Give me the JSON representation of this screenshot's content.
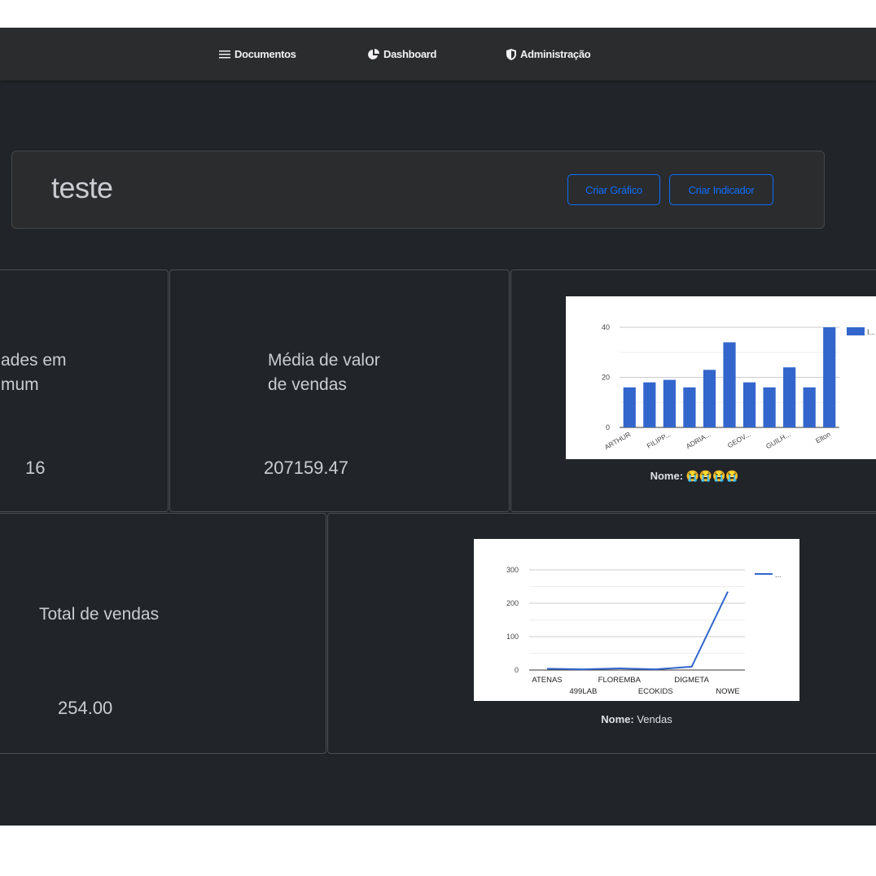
{
  "nav": {
    "documents_label": "Documentos",
    "dashboard_label": "Dashboard",
    "admin_label": "Administração"
  },
  "header": {
    "title": "teste",
    "create_chart_label": "Criar Gráfico",
    "create_indicator_label": "Criar Indicador"
  },
  "indicators": [
    {
      "title_line1": "ades em",
      "title_line2": "mum",
      "value": "16"
    },
    {
      "title_line1": "Média de valor",
      "title_line2": "de vendas",
      "value": "207159.47"
    },
    {
      "title_line1": "Total de vendas",
      "title_line2": "",
      "value": "254.00"
    }
  ],
  "charts_caption": [
    {
      "label": "Nome:",
      "text": "😭😭😭😭"
    },
    {
      "label": "Nome:",
      "text": "Vendas"
    }
  ],
  "colors": {
    "bar": "#3366cc",
    "line": "#3366cc",
    "accent": "#0d6efd"
  },
  "chart_data": [
    {
      "type": "bar",
      "categories": [
        "ARTHUR",
        "",
        "FILIPP...",
        "",
        "ADRIA...",
        "",
        "GEOV...",
        "",
        "GUILH...",
        "",
        "Elton"
      ],
      "values": [
        16,
        18,
        19,
        16,
        23,
        34,
        18,
        16,
        24,
        16,
        40
      ],
      "ylim": [
        0,
        40
      ],
      "yticks": [
        0,
        20,
        40
      ],
      "legend": "I...",
      "legend_position": "right"
    },
    {
      "type": "line",
      "x": [
        "ATENAS",
        "499LAB",
        "FLOREMBA",
        "ECOKIDS",
        "DIGMETA",
        "NOWE"
      ],
      "values": [
        4,
        2,
        5,
        2,
        10,
        235
      ],
      "ylim": [
        0,
        300
      ],
      "yticks": [
        0,
        100,
        200,
        300
      ],
      "legend": "...",
      "legend_position": "right"
    }
  ]
}
